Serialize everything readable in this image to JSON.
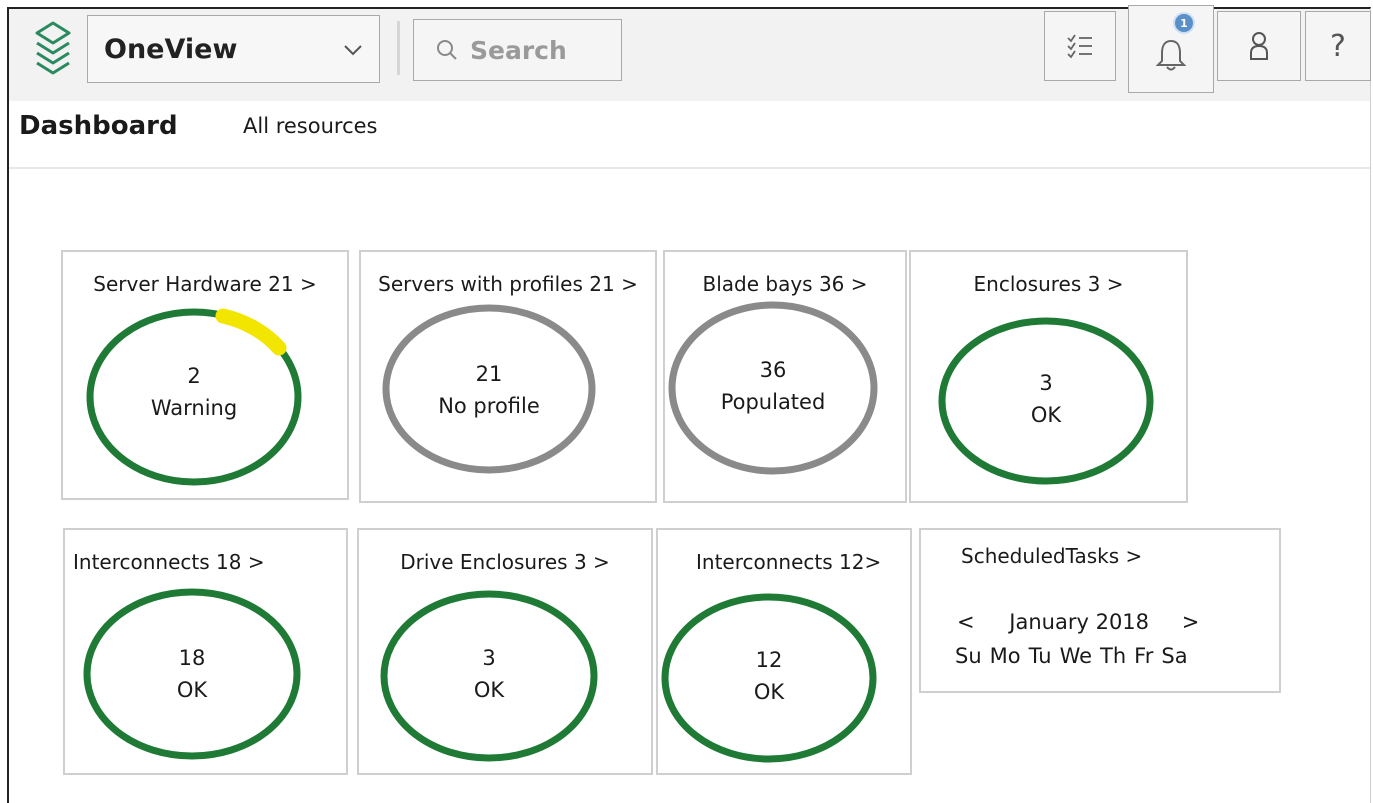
{
  "header": {
    "app_name": "OneView",
    "search_placeholder": "Search",
    "notification_count": "1",
    "help_label": "?"
  },
  "nav": {
    "title": "Dashboard",
    "link": "All resources"
  },
  "colors": {
    "ok": "#1f7a35",
    "neutral": "#8a8a8a",
    "warning": "#f2e500"
  },
  "tiles": [
    {
      "title": "Server Hardware 21 >",
      "count": "2",
      "status": "Warning"
    },
    {
      "title": "Servers with profiles 21 >",
      "count": "21",
      "status": "No profile"
    },
    {
      "title": "Blade bays 36 >",
      "count": "36",
      "status": "Populated"
    },
    {
      "title": "Enclosures 3 >",
      "count": "3",
      "status": "OK"
    },
    {
      "title": "Interconnects 18 >",
      "count": "18",
      "status": "OK"
    },
    {
      "title": "Drive Enclosures 3 >",
      "count": "3",
      "status": "OK"
    },
    {
      "title": "Interconnects 12>",
      "count": "12",
      "status": "OK"
    }
  ],
  "scheduled": {
    "title": "ScheduledTasks >",
    "prev": "<",
    "month": "January 2018",
    "next": ">",
    "days": [
      "Su",
      "Mo",
      "Tu",
      "We",
      "Th",
      "Fr",
      "Sa"
    ]
  }
}
